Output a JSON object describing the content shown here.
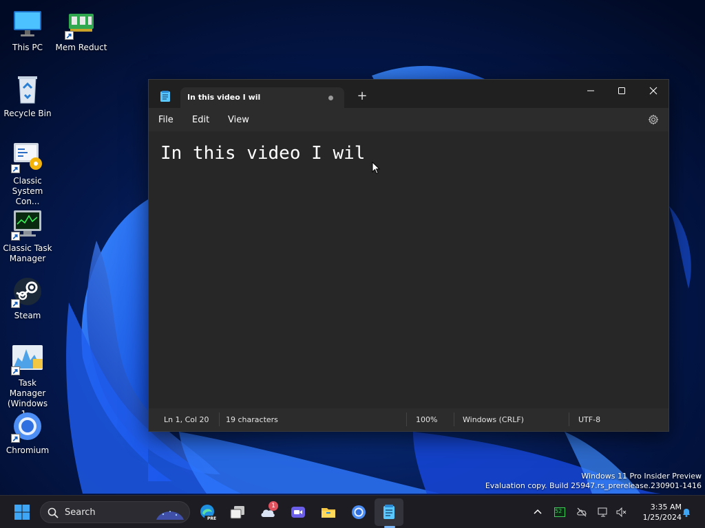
{
  "desktop": {
    "icons": [
      {
        "label": "This PC"
      },
      {
        "label": "Mem Reduct"
      },
      {
        "label": "Recycle Bin"
      },
      {
        "label": "Classic System Con..."
      },
      {
        "label": "Classic Task Manager"
      },
      {
        "label": "Steam"
      },
      {
        "label": "Task Manager (Windows 1..."
      },
      {
        "label": "Chromium"
      }
    ],
    "watermark": {
      "line1": "Windows 11 Pro Insider Preview",
      "line2": "Evaluation copy. Build 25947.rs_prerelease.230901-1416"
    }
  },
  "notepad": {
    "tab_title": "In this video I wil",
    "new_tab_symbol": "+",
    "menu": {
      "file": "File",
      "edit": "Edit",
      "view": "View"
    },
    "content": "In this video I wil",
    "status": {
      "position": "Ln 1, Col 20",
      "characters": "19 characters",
      "zoom": "100%",
      "line_ending": "Windows (CRLF)",
      "encoding": "UTF-8"
    }
  },
  "taskbar": {
    "search_label": "Search",
    "edge_badge": "PRE",
    "notification_count": "1",
    "tray_cpu": "52",
    "clock": {
      "time": "3:35 AM",
      "date": "1/25/2024"
    }
  },
  "colors": {
    "accent": "#0078d4",
    "editor_bg": "#272727",
    "window_bg": "#202020"
  }
}
